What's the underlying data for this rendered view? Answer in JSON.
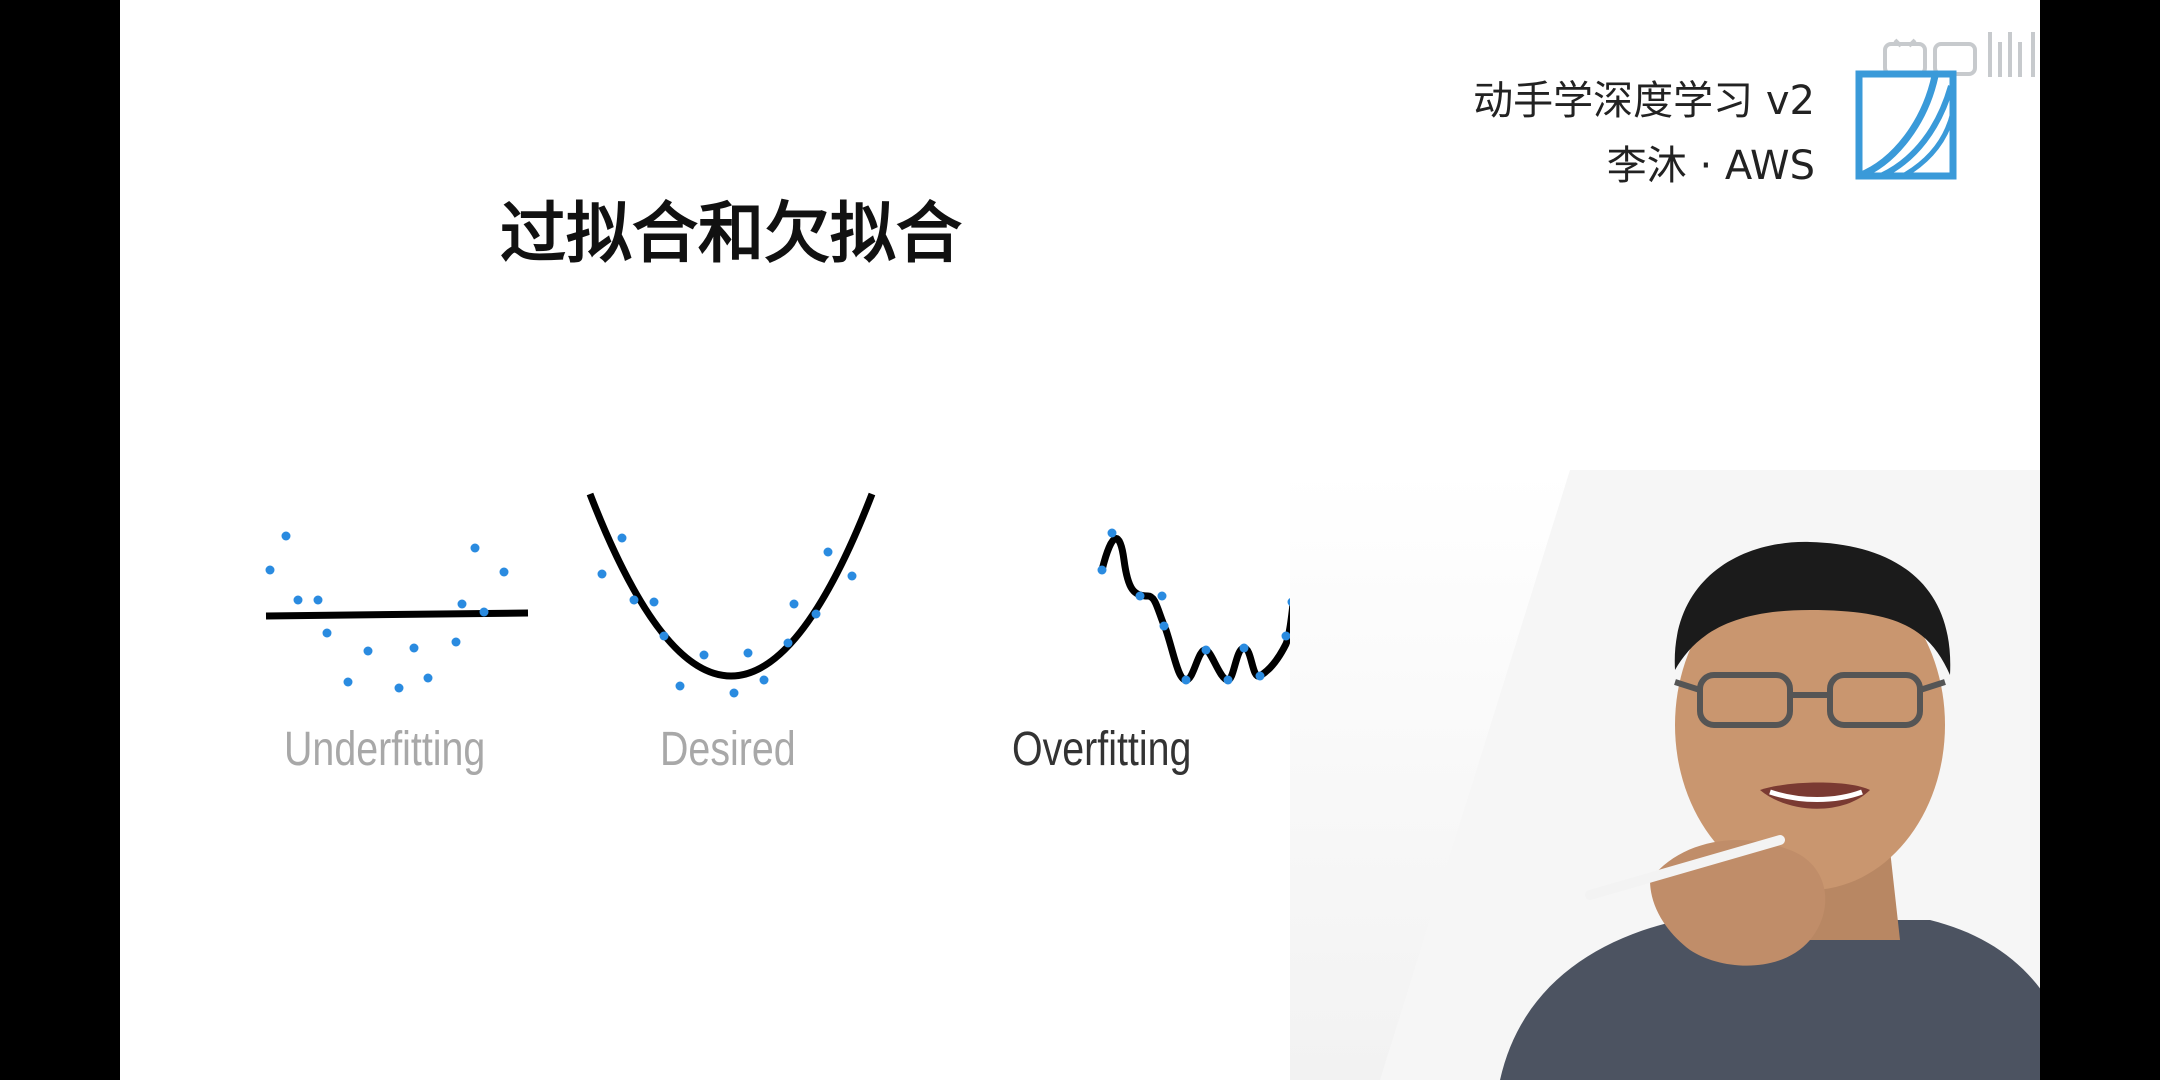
{
  "header": {
    "course_title": "动手学深度学习 v2",
    "author": "李沐 · AWS"
  },
  "slide": {
    "title": "过拟合和欠拟合"
  },
  "figures": [
    {
      "label": "Underfitting",
      "label_color": "#a8a8a8",
      "icon": "underfitting-plot"
    },
    {
      "label": "Desired",
      "label_color": "#a8a8a8",
      "icon": "desired-fit-plot"
    },
    {
      "label": "Overfitting",
      "label_color": "#333333",
      "icon": "overfitting-plot"
    }
  ],
  "colors": {
    "point": "#2a8be0",
    "curve": "#000000",
    "logo": "#3a9ad9",
    "slide_bg": "#ffffff",
    "letterbox": "#000000"
  },
  "icons": {
    "logo": "d2l-book-logo",
    "watermark": "bilibili-watermark",
    "presenter": "presenter-video"
  }
}
